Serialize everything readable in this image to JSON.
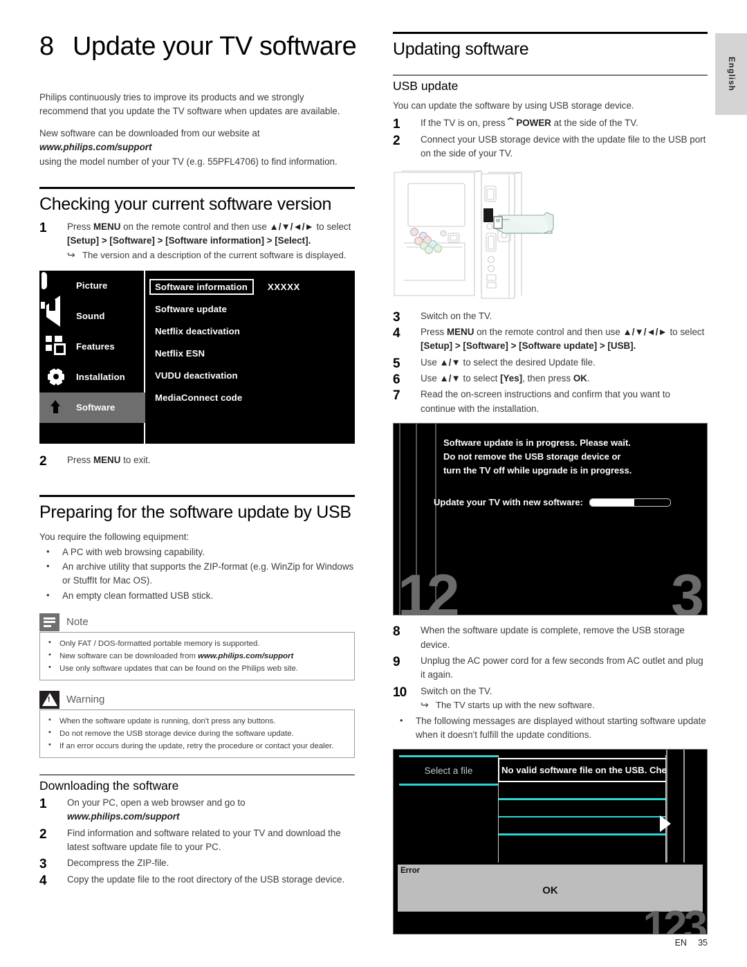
{
  "language_tab": "English",
  "chapter": {
    "number": "8",
    "title": "Update your TV software"
  },
  "intro": {
    "p1": "Philips continuously tries to improve its products and we strongly recommend that you update the TV software when updates are available.",
    "p2_a": "New software can be downloaded from our website at",
    "p2_url": "www.philips.com/support",
    "p2_b": "using the model number of your TV (e.g. 55PFL4706) to find information."
  },
  "checking": {
    "heading": "Checking your current software version",
    "step1": {
      "num": "1",
      "text_a": "Press ",
      "menu": "MENU",
      "text_b": " on the remote control and then use ",
      "arrows": "▲/▼/◄/►",
      "text_c": " to select ",
      "path": "[Setup] > [Software] > [Software information] > [Select].",
      "result": "The version and a description of the current software is displayed."
    },
    "step2": {
      "num": "2",
      "text_a": "Press ",
      "menu": "MENU",
      "text_b": " to exit."
    }
  },
  "osd_menu": {
    "left_items": [
      {
        "label": "Picture",
        "icon": "picture-icon",
        "active": false
      },
      {
        "label": "Sound",
        "icon": "sound-icon",
        "active": false
      },
      {
        "label": "Features",
        "icon": "features-icon",
        "active": false
      },
      {
        "label": "Installation",
        "icon": "gear-icon",
        "active": false
      },
      {
        "label": "Software",
        "icon": "software-arrow-icon",
        "active": true
      }
    ],
    "right_items": [
      {
        "label": "Software information",
        "value": "XXXXX",
        "selected": true
      },
      {
        "label": "Software update",
        "value": "",
        "selected": false
      },
      {
        "label": "Netflix deactivation",
        "value": "",
        "selected": false
      },
      {
        "label": "Netflix ESN",
        "value": "",
        "selected": false
      },
      {
        "label": "VUDU deactivation",
        "value": "",
        "selected": false
      },
      {
        "label": "MediaConnect code",
        "value": "",
        "selected": false
      }
    ]
  },
  "preparing": {
    "heading": "Preparing for the software update by USB",
    "intro": "You require the following equipment:",
    "bullets": [
      "A PC with web browsing capability.",
      "An archive utility that supports the ZIP-format (e.g. WinZip for Windows or StuffIt for Mac OS).",
      "An empty clean formatted USB stick."
    ]
  },
  "note": {
    "title": "Note",
    "items_pre": [
      "Only FAT / DOS-formatted portable memory is supported.",
      "New software can be downloaded from ",
      "Use only software updates that can be found on the Philips web site."
    ],
    "url": "www.philips.com/support"
  },
  "warning": {
    "title": "Warning",
    "items": [
      "When the software update is running, don't press any buttons.",
      "Do not remove the USB storage device during the software update.",
      "If an error occurs during the update, retry the procedure or contact your dealer."
    ]
  },
  "downloading": {
    "heading": "Downloading the software",
    "steps": [
      {
        "num": "1",
        "text": "On your PC, open a web browser and go to",
        "url": "www.philips.com/support"
      },
      {
        "num": "2",
        "text": "Find information and software related to your TV and download the latest software update file to your PC."
      },
      {
        "num": "3",
        "text": "Decompress the ZIP-file."
      },
      {
        "num": "4",
        "text": "Copy the update file to the root directory of the USB storage device."
      }
    ]
  },
  "updating": {
    "heading": "Updating software",
    "subheading": "USB update",
    "intro": "You can update the software by using USB storage device.",
    "step1": {
      "num": "1",
      "a": "If the TV is on, press ",
      "power": "POWER",
      "b": " at the side of the TV."
    },
    "step2": {
      "num": "2",
      "text": "Connect your USB storage device with the update file to the USB port on the side of your TV."
    },
    "step3": {
      "num": "3",
      "text": "Switch on the TV."
    },
    "step4": {
      "num": "4",
      "a": "Press ",
      "menu": "MENU",
      "b": " on the remote control and then use ",
      "arrows": "▲/▼/◄/►",
      "c": " to select ",
      "path": "[Setup] > [Software] > [Software update] > [USB]."
    },
    "step5": {
      "num": "5",
      "a": "Use ",
      "arrows": "▲/▼",
      "b": " to select the desired Update file."
    },
    "step6": {
      "num": "6",
      "a": "Use ",
      "arrows": "▲/▼",
      "b": " to select ",
      "yes": "[Yes]",
      "c": ", then press ",
      "ok": "OK",
      "d": "."
    },
    "step7": {
      "num": "7",
      "text": "Read the on-screen instructions and confirm that you want to continue with the installation."
    },
    "step8": {
      "num": "8",
      "text": "When the software update is complete, remove the USB storage device."
    },
    "step9": {
      "num": "9",
      "text": "Unplug the AC power cord for a few seconds from AC outlet and plug it again."
    },
    "step10": {
      "num": "10",
      "text": "Switch on the TV.",
      "result": "The TV starts up with the new software."
    },
    "final_bullet": "The following messages are displayed without starting software update when it doesn't fulfill the update conditions."
  },
  "progress_osd": {
    "line1": "Software update is in progress. Please wait.",
    "line2": "Do not remove the USB storage device or",
    "line3": "turn the TV off while upgrade is in progress.",
    "label": "Update your TV with new software:",
    "progress_percent": 55,
    "watermark_left": "12",
    "watermark_right": "3"
  },
  "error_osd": {
    "select_a_file": "Select a file",
    "message": "No valid software file on the USB. Chec",
    "error_label": "Error",
    "ok_button": "OK",
    "watermark": "123"
  },
  "footer": {
    "en": "EN",
    "page": "35"
  },
  "colors": {
    "osd_background": "#000000",
    "osd_highlight": "#6e6e6e",
    "cyan_accent": "#2ed6d6",
    "gray_dialog": "#bdbdbd",
    "lang_tab": "#d4d4d4"
  }
}
